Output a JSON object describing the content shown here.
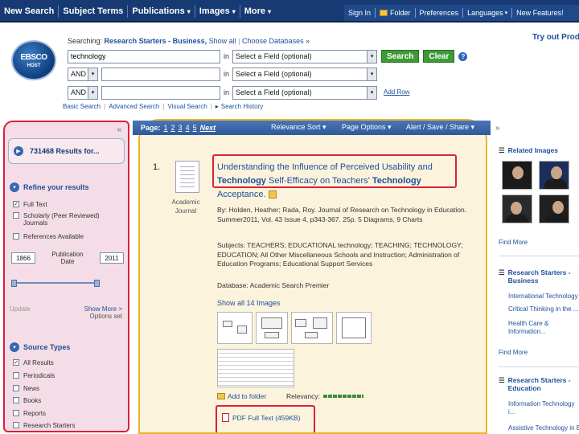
{
  "topnav": {
    "items": [
      "New Search",
      "Subject Terms",
      "Publications",
      "Images",
      "More"
    ],
    "caret": "▾",
    "right": {
      "sign_in": "Sign In",
      "folder": "Folder",
      "preferences": "Preferences",
      "languages": "Languages",
      "new_features": "New Features!"
    }
  },
  "logo": {
    "line1": "EBSCO",
    "line2": "HOST"
  },
  "searching": {
    "label": "Searching:",
    "databases": "Research Starters - Business,",
    "show_all": "Show all",
    "choose": "Choose Databases »"
  },
  "try_out": "Try out Prod",
  "search": {
    "term": "technology",
    "bool1": "AND",
    "bool2": "AND",
    "in": "in",
    "field_placeholder": "Select a Field (optional)",
    "search_btn": "Search",
    "clear_btn": "Clear",
    "help": "?",
    "add_row": "Add Row",
    "links": [
      "Basic Search",
      "Advanced Search",
      "Visual Search",
      "Search History"
    ],
    "link_sep": "|",
    "history_arrow": "▸"
  },
  "left": {
    "collapse": "«",
    "results": "731468 Results for...",
    "refine": "Refine your results",
    "filters": [
      {
        "label": "Full Text",
        "checked": true
      },
      {
        "label": "Scholarly (Peer Reviewed) Journals",
        "checked": false
      },
      {
        "label": "References Available",
        "checked": false
      }
    ],
    "date_from": "1866",
    "date_to": "2011",
    "pub_label": "Publication Date",
    "update": "Update",
    "show_more": "Show More >",
    "options_set": "Options set",
    "source_types": "Source Types",
    "sources": [
      {
        "label": "All Results",
        "checked": true
      },
      {
        "label": "Periodicals",
        "checked": false
      },
      {
        "label": "News",
        "checked": false
      },
      {
        "label": "Books",
        "checked": false
      },
      {
        "label": "Reports",
        "checked": false
      },
      {
        "label": "Research Starters",
        "checked": false
      }
    ]
  },
  "pagebar": {
    "page_label": "Page:",
    "pages": [
      "1",
      "2",
      "3",
      "4",
      "5"
    ],
    "next": "Next",
    "relevance": "Relevance Sort ▾",
    "page_options": "Page Options ▾",
    "alert": "Alert / Save / Share ▾"
  },
  "record": {
    "number": "1.",
    "type_label": "Academic Journal",
    "title_part1": "Understanding the Influence of Perceived Usability and ",
    "title_bold1": "Technology",
    "title_part2": " Self-Efficacy on Teachers' ",
    "title_bold2": "Technology",
    "title_part3": " Acceptance.",
    "byline": "By: Holden, Heather; Rada, Roy. Journal of Research on Technology in Education. Summer2011, Vol. 43 Issue 4, p343-367. 25p. 5 Diagrams, 9 Charts",
    "subjects": "Subjects: TEACHERS; EDUCATIONAL technology; TEACHING; TECHNOLOGY; EDUCATION; All Other Miscellaneous Schools and Instruction; Administration of Education Programs; Educational Support Services",
    "database": "Database: Academic Search Premier",
    "show_images": "Show all 14 Images",
    "add_folder": "Add to folder",
    "relevancy": "Relevancy:",
    "pdf": "PDF Full Text (459KB)"
  },
  "right": {
    "expand": "»",
    "marker": "☰",
    "related_images": "Related Images",
    "find_more": "Find More",
    "rs_business": "Research Starters - Business",
    "business_links": [
      "International Technology",
      "Critical Thinking in the ...",
      "Health Care & Information..."
    ],
    "rs_education": "Research Starters - Education",
    "education_links": [
      "Information Technology i...",
      "Assistive Technology in E"
    ]
  },
  "colors": {
    "nav": "#173a73",
    "link": "#1d4f9a",
    "highlight_red": "#d8223a",
    "highlight_yellow": "#e8b62a",
    "button_green": "#3e9a36"
  }
}
